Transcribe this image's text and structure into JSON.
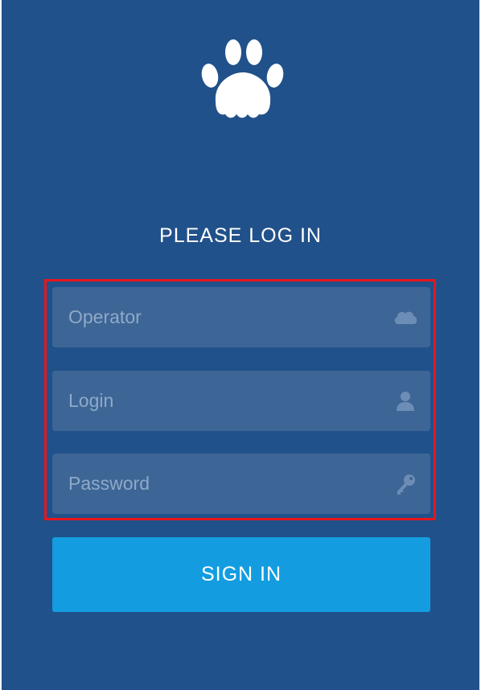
{
  "logo": {
    "icon": "paw-icon",
    "color": "#ffffff"
  },
  "heading": {
    "text": "PLEASE LOG IN"
  },
  "form": {
    "operator": {
      "value": "",
      "placeholder": "Operator",
      "icon": "cloud-icon"
    },
    "login": {
      "value": "",
      "placeholder": "Login",
      "icon": "user-icon"
    },
    "password": {
      "value": "",
      "placeholder": "Password",
      "icon": "key-icon"
    },
    "highlight_color": "#e8161b"
  },
  "sign_in": {
    "label": "SIGN IN",
    "color": "#139de0"
  },
  "colors": {
    "background": "#21518a",
    "field_background": "#3d6696",
    "placeholder": "#8fa9c8"
  }
}
